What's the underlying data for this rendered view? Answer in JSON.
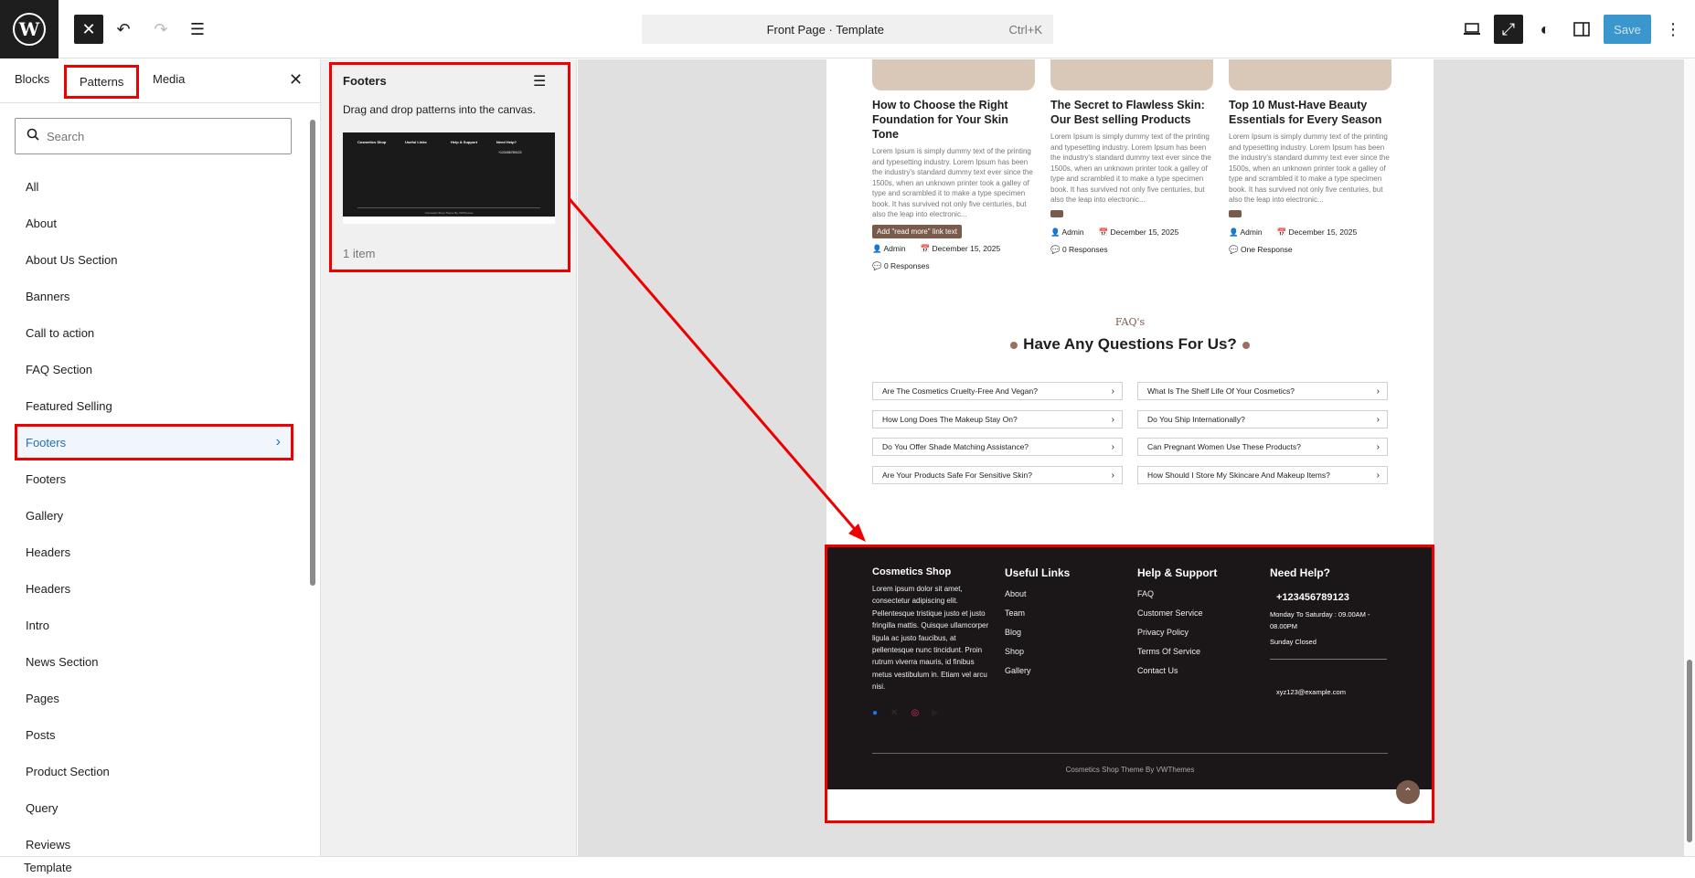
{
  "topbar": {
    "command_title": "Front Page · Template",
    "command_shortcut": "Ctrl+K",
    "save_label": "Save"
  },
  "inserter": {
    "tabs": [
      "Blocks",
      "Patterns",
      "Media"
    ],
    "search_placeholder": "Search",
    "categories": [
      "All",
      "About",
      "About Us Section",
      "Banners",
      "Call to action",
      "FAQ Section",
      "Featured Selling",
      "Footers",
      "Footers",
      "Gallery",
      "Headers",
      "Headers",
      "Intro",
      "News Section",
      "Pages",
      "Posts",
      "Product Section",
      "Query",
      "Reviews"
    ]
  },
  "pattern_panel": {
    "title": "Footers",
    "description": "Drag and drop patterns into the canvas.",
    "count": "1 item",
    "thumbnail": {
      "cols": [
        "Cosmetics Shop",
        "Useful Links",
        "Help & Support",
        "Need Help?"
      ],
      "phone": "+123456789123",
      "bottom": "Cosmetics Shop Theme By VWThemes"
    }
  },
  "posts": [
    {
      "title": "How to Choose the Right Foundation for Your Skin Tone",
      "excerpt": "Lorem Ipsum is simply dummy text of the printing and typesetting industry. Lorem Ipsum has been the industry's standard dummy text ever since the 1500s, when an unknown printer took a galley of type and scrambled it to make a type specimen book. It has survived not only five centuries, but also the leap into electronic...",
      "read_more": "Add \"read more\" link text",
      "author": "Admin",
      "date": "December 15, 2025",
      "responses": "0 Responses"
    },
    {
      "title": "The Secret to Flawless Skin: Our Best selling Products",
      "excerpt": "Lorem Ipsum is simply dummy text of the printing and typesetting industry. Lorem Ipsum has been the industry's standard dummy text ever since the 1500s, when an unknown printer took a galley of type and scrambled it to make a type specimen book. It has survived not only five centuries, but also the leap into electronic...",
      "author": "Admin",
      "date": "December 15, 2025",
      "responses": "0 Responses"
    },
    {
      "title": "Top 10 Must-Have Beauty Essentials for Every Season",
      "excerpt": "Lorem Ipsum is simply dummy text of the printing and typesetting industry. Lorem Ipsum has been the industry's standard dummy text ever since the 1500s, when an unknown printer took a galley of type and scrambled it to make a type specimen book. It has survived not only five centuries, but also the leap into electronic...",
      "author": "Admin",
      "date": "December 15, 2025",
      "responses": "One Response"
    }
  ],
  "faq": {
    "label": "FAQ's",
    "heading": "Have Any Questions For Us?",
    "questions_left": [
      "Are The Cosmetics Cruelty-Free And Vegan?",
      "How Long Does The Makeup Stay On?",
      "Do You Offer Shade Matching Assistance?",
      "Are Your Products Safe For Sensitive Skin?"
    ],
    "questions_right": [
      "What Is The Shelf Life Of Your Cosmetics?",
      "Do You Ship Internationally?",
      "Can Pregnant Women Use These Products?",
      "How Should I Store My Skincare And Makeup Items?"
    ]
  },
  "footer": {
    "brand": "Cosmetics Shop",
    "about": "Lorem ipsum dolor sit amet, consectetur adipiscing elit. Pellentesque tristique justo et justo fringilla mattis. Quisque ullamcorper ligula ac justo faucibus, at pellentesque nunc tincidunt. Proin rutrum viverra mauris, id finibus metus vestibulum in. Etiam vel arcu nisi.",
    "useful_links_title": "Useful Links",
    "useful_links": [
      "About",
      "Team",
      "Blog",
      "Shop",
      "Gallery"
    ],
    "help_title": "Help & Support",
    "help_links": [
      "FAQ",
      "Customer Service",
      "Privacy Policy",
      "Terms Of Service",
      "Contact Us"
    ],
    "need_help_title": "Need Help?",
    "phone": "+123456789123",
    "hours": "Monday To Saturday : 09.00AM - 08.00PM",
    "closed": "Sunday Closed",
    "email": "xyz123@example.com",
    "credit": "Cosmetics Shop Theme By VWThemes"
  },
  "statusbar": {
    "label": "Template"
  },
  "colors": {
    "highlight": "#e00000",
    "accent": "#7a5a4a",
    "footer_bg": "#1b1718"
  }
}
